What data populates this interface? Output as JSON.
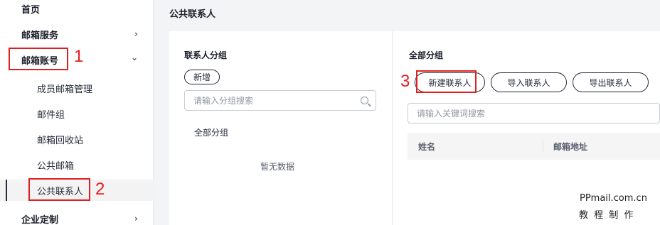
{
  "sidebar": {
    "items": [
      {
        "label": "首页"
      },
      {
        "label": "邮箱服务",
        "chevron": "›"
      },
      {
        "label": "邮箱账号",
        "chevron": "⌄"
      },
      {
        "label": "成员邮箱管理"
      },
      {
        "label": "邮件组"
      },
      {
        "label": "邮箱回收站"
      },
      {
        "label": "公共邮箱"
      },
      {
        "label": "公共联系人"
      },
      {
        "label": "企业定制",
        "chevron": "›"
      }
    ]
  },
  "annotations": {
    "n1": "1",
    "n2": "2",
    "n3": "3"
  },
  "page": {
    "title": "公共联系人"
  },
  "groups": {
    "title": "联系人分组",
    "add_label": "新增",
    "search_placeholder": "请输入分组搜索",
    "all_groups": "全部分组",
    "empty": "暂无数据"
  },
  "contacts": {
    "title": "全部分组",
    "new_label": "新建联系人",
    "import_label": "导入联系人",
    "export_label": "导出联系人",
    "search_placeholder": "请输入关键词搜索",
    "columns": [
      "姓名",
      "邮箱地址"
    ]
  },
  "watermark": {
    "line1": "PPmail.com.cn",
    "line2": "教 程 制 作"
  },
  "colors": {
    "annotation": "#e02020",
    "text": "#252b3a"
  },
  "icons": {
    "search": "search-icon",
    "chevron_right": "chevron-right-icon",
    "chevron_down": "chevron-down-icon"
  }
}
